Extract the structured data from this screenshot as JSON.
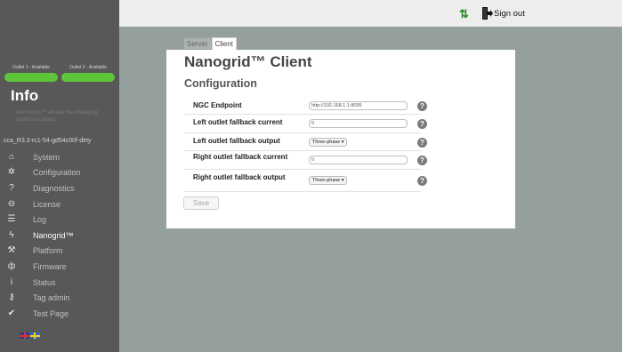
{
  "header": {
    "signout_label": "Sign out"
  },
  "sidebar": {
    "outlets": [
      {
        "label": "Outlet 1 - Available",
        "color": "#5ec43a"
      },
      {
        "label": "Outlet 2 - Available",
        "color": "#5ec43a"
      }
    ],
    "title": "Info",
    "description": "NanoGrid™ allows the charging station to adapt",
    "version": "cca_R3.3-rc1-54-gd54c00f-dirty",
    "items": [
      {
        "label": "System",
        "icon": "home-icon"
      },
      {
        "label": "Configuration",
        "icon": "gear-icon"
      },
      {
        "label": "Diagnostics",
        "icon": "question-icon"
      },
      {
        "label": "License",
        "icon": "lock-icon"
      },
      {
        "label": "Log",
        "icon": "list-icon"
      },
      {
        "label": "Nanogrid™",
        "icon": "lightning-icon",
        "active": true
      },
      {
        "label": "Platform",
        "icon": "wrench-icon"
      },
      {
        "label": "Firmware",
        "icon": "plug-icon"
      },
      {
        "label": "Status",
        "icon": "info-icon"
      },
      {
        "label": "Tag admin",
        "icon": "key-icon"
      },
      {
        "label": "Test Page",
        "icon": "checkmark-icon"
      }
    ]
  },
  "tabs": [
    {
      "label": "Server",
      "active": false
    },
    {
      "label": "Client",
      "active": true
    }
  ],
  "page": {
    "title": "Nanogrid™ Client",
    "section": "Configuration",
    "fields": {
      "ngc_endpoint": {
        "label": "NGC Endpoint",
        "value": "http://192.168.1.1:8095"
      },
      "left_current": {
        "label": "Left outlet fallback current",
        "value": "0"
      },
      "left_output": {
        "label": "Left outlet fallback output",
        "value": "Three-phase ▾"
      },
      "right_current": {
        "label": "Right outlet fallback current",
        "value": "0"
      },
      "right_output": {
        "label": "Right outlet fallback output",
        "value": "Three-phase ▾"
      }
    },
    "help_glyph": "?",
    "save_label": "Save"
  },
  "colors": {
    "accent_green": "#5ec43a",
    "sort_icon_green": "#2e8a2e",
    "sidebar_bg": "#585858",
    "content_bg": "#95a09d"
  }
}
